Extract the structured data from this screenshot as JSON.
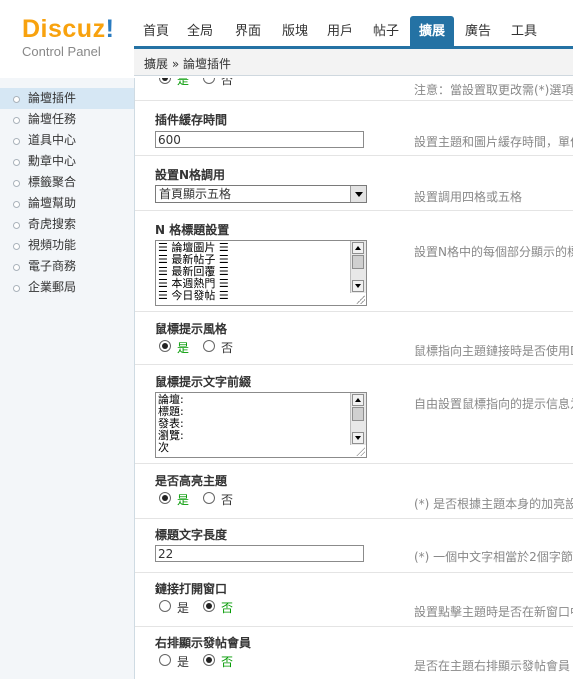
{
  "logo": {
    "brand": "Discuz",
    "bang": "!",
    "subtitle": "Control Panel"
  },
  "topnav": [
    {
      "label": "首頁"
    },
    {
      "label": "全局"
    },
    {
      "label": "界面"
    },
    {
      "label": "版塊"
    },
    {
      "label": "用戶"
    },
    {
      "label": "帖子"
    },
    {
      "label": "擴展",
      "active": true
    },
    {
      "label": "廣告"
    },
    {
      "label": "工具"
    }
  ],
  "breadcrumb": "擴展 » 論壇插件",
  "sidebar": [
    {
      "label": "論壇插件",
      "active": true
    },
    {
      "label": "論壇任務"
    },
    {
      "label": "道具中心"
    },
    {
      "label": "勳章中心"
    },
    {
      "label": "標籤聚合"
    },
    {
      "label": "論壇幫助"
    },
    {
      "label": "奇虎搜索"
    },
    {
      "label": "視頻功能"
    },
    {
      "label": "電子商務"
    },
    {
      "label": "企業郵局"
    }
  ],
  "top_fragment": {
    "yes": "是",
    "no": "否",
    "desc": "注意：當設置取更改需(*)選項"
  },
  "sections": {
    "cache": {
      "title": "插件緩存時間",
      "value": "600",
      "desc": "設置主題和圖片緩存時間，單位"
    },
    "ngrid": {
      "title": "設置N格調用",
      "selected": "首頁顯示五格",
      "desc": "設置調用四格或五格"
    },
    "ntitle": {
      "title": "N 格標題設置",
      "lines": [
        "☰ 論壇圖片 ☰",
        "☰ 最新帖子 ☰",
        "☰ 最新回覆 ☰",
        "☰ 本週熱門 ☰",
        "☰ 今日發帖 ☰"
      ],
      "desc": "設置N格中的每個部分顯示的標"
    },
    "tipstyle": {
      "title": "鼠標提示風格",
      "yes": "是",
      "no": "否",
      "desc": "鼠標指向主題鏈接時是否使用D"
    },
    "tipprefix": {
      "title": "鼠標提示文字前綴",
      "lines": [
        "論壇:",
        "標題:",
        "發表:",
        "瀏覽:",
        "次"
      ],
      "desc": "自由設置鼠標指向的提示信息为"
    },
    "highlight": {
      "title": "是否高亮主題",
      "yes": "是",
      "no": "否",
      "desc": "(*) 是否根據主題本身的加亮設"
    },
    "titlelen": {
      "title": "標題文字長度",
      "value": "22",
      "desc": "(*) 一個中文字相當於2個字節"
    },
    "newwin": {
      "title": "鏈接打開窗口",
      "yes": "是",
      "no": "否",
      "desc": "設置點擊主題時是否在新窗口中"
    },
    "rightmember": {
      "title": "右排顯示發帖會員",
      "yes": "是",
      "no": "否",
      "desc": "是否在主題右排顯示發帖會員"
    }
  }
}
